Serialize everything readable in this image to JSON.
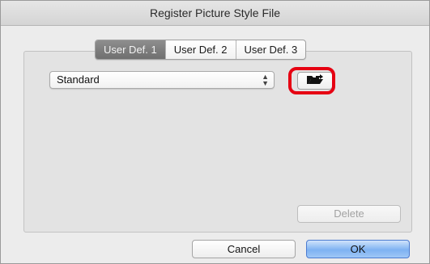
{
  "window": {
    "title": "Register Picture Style File"
  },
  "tabs": [
    {
      "label": "User Def. 1",
      "active": true
    },
    {
      "label": "User Def. 2",
      "active": false
    },
    {
      "label": "User Def. 3",
      "active": false
    }
  ],
  "style_select": {
    "value": "Standard",
    "arrows": "⇕"
  },
  "load_button": {
    "icon": "folder-open-icon"
  },
  "buttons": {
    "delete": "Delete",
    "cancel": "Cancel",
    "ok": "OK"
  },
  "colors": {
    "highlight": "#e60012",
    "ok_accent": "#7eb2f2",
    "active_tab": "#7a7a7a"
  }
}
